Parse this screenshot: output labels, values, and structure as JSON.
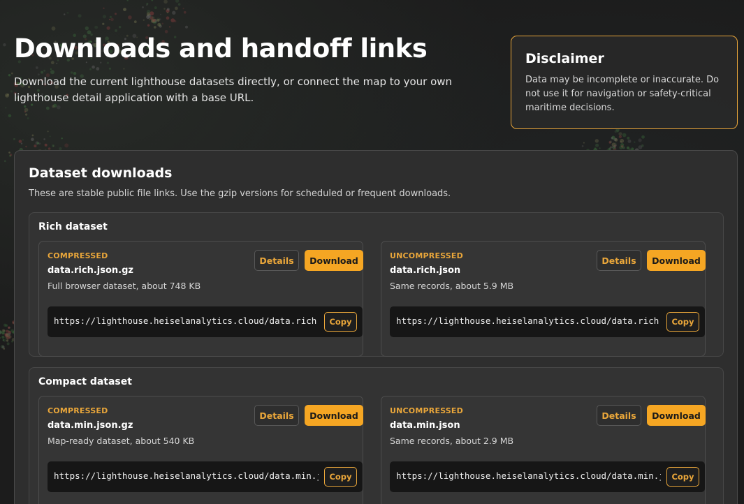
{
  "hero": {
    "title": "Downloads and handoff links",
    "description": "Download the current lighthouse datasets directly, or connect the map to your own lighthouse detail application with a base URL."
  },
  "disclaimer": {
    "title": "Disclaimer",
    "text": "Data may be incomplete or inaccurate. Do not use it for navigation or safety-critical maritime decisions."
  },
  "downloads": {
    "title": "Dataset downloads",
    "subtitle": "These are stable public file links. Use the gzip versions for scheduled or frequent downloads.",
    "groups": [
      {
        "title": "Rich dataset",
        "cards": [
          {
            "kind": "COMPRESSED",
            "filename": "data.rich.json.gz",
            "description": "Full browser dataset, about 748 KB",
            "details_label": "Details",
            "download_label": "Download",
            "url": "https://lighthouse.heiselanalytics.cloud/data.rich.json.gz",
            "copy_label": "Copy"
          },
          {
            "kind": "UNCOMPRESSED",
            "filename": "data.rich.json",
            "description": "Same records, about 5.9 MB",
            "details_label": "Details",
            "download_label": "Download",
            "url": "https://lighthouse.heiselanalytics.cloud/data.rich.json",
            "copy_label": "Copy"
          }
        ]
      },
      {
        "title": "Compact dataset",
        "cards": [
          {
            "kind": "COMPRESSED",
            "filename": "data.min.json.gz",
            "description": "Map-ready dataset, about 540 KB",
            "details_label": "Details",
            "download_label": "Download",
            "url": "https://lighthouse.heiselanalytics.cloud/data.min.json.gz",
            "copy_label": "Copy"
          },
          {
            "kind": "UNCOMPRESSED",
            "filename": "data.min.json",
            "description": "Same records, about 2.9 MB",
            "details_label": "Details",
            "download_label": "Download",
            "url": "https://lighthouse.heiselanalytics.cloud/data.min.json",
            "copy_label": "Copy"
          }
        ]
      }
    ]
  },
  "colors": {
    "accent": "#f5a623",
    "accent_text": "#e9a63a",
    "background": "#1c1c1c",
    "panel": "#2e2e2e"
  }
}
